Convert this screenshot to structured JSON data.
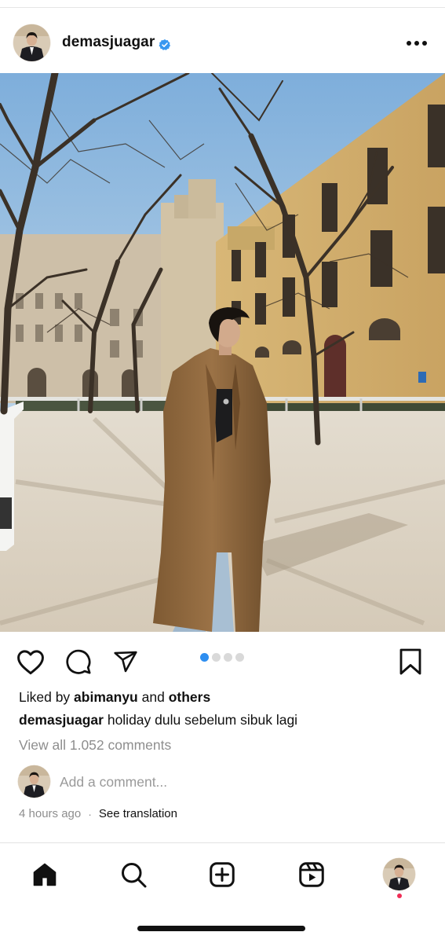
{
  "post": {
    "username": "demasjuagar",
    "verified": true,
    "photo_alt": "Man in long brown coat standing in sunny courtyard with bare trees and yellow stone buildings",
    "carousel": {
      "count": 4,
      "active_index": 1
    },
    "liked_prefix": "Liked by ",
    "liked_user": "abimanyu",
    "liked_and": " and ",
    "liked_others": "others",
    "caption_user": "demasjuagar",
    "caption_text": " holiday dulu sebelum sibuk lagi",
    "view_comments": "View all 1.052 comments",
    "comment_placeholder": "Add a comment...",
    "time_ago": "4 hours ago",
    "separator": "·",
    "see_translation": "See translation"
  },
  "icons": {
    "more": "more-dots-icon",
    "like": "heart-icon",
    "comment": "comment-bubble-icon",
    "share": "paper-plane-icon",
    "save": "bookmark-icon",
    "home": "home-icon",
    "search": "search-icon",
    "create": "plus-square-icon",
    "reels": "reels-icon"
  },
  "colors": {
    "verified_badge": "#3897f0",
    "carousel_active": "#2e8ef0",
    "notification_dot": "#ef2d56",
    "muted_text": "#8e8e8e"
  }
}
